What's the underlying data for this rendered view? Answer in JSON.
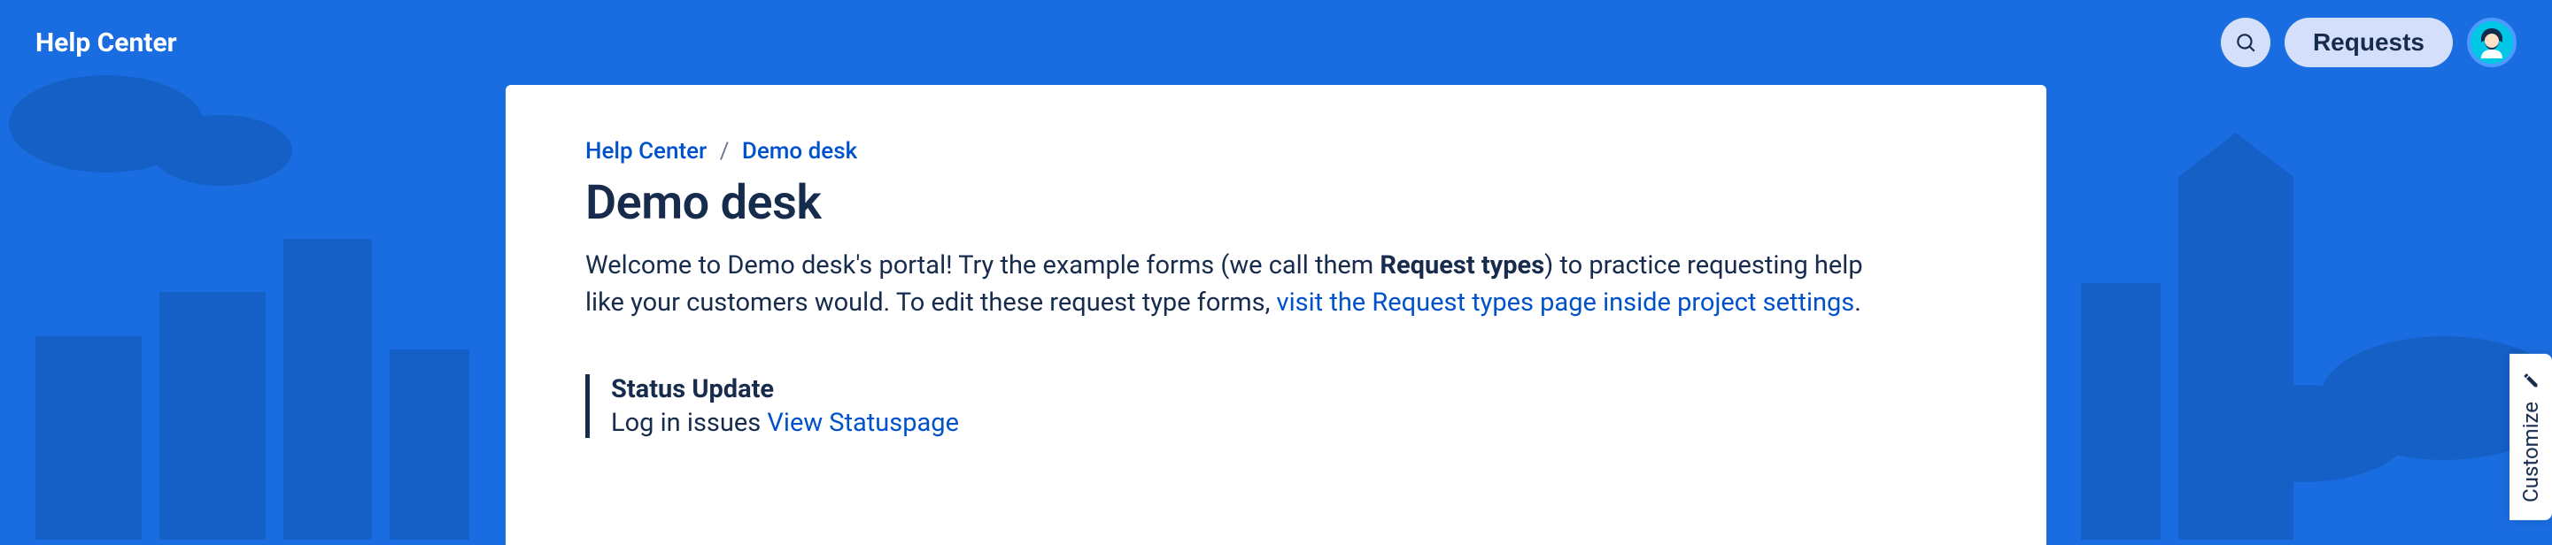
{
  "header": {
    "brand": "Help Center",
    "requests_label": "Requests"
  },
  "breadcrumb": {
    "root": "Help Center",
    "current": "Demo desk"
  },
  "page": {
    "title": "Demo desk",
    "desc_part1": "Welcome to Demo desk's portal! Try the example forms (we call them ",
    "desc_bold": "Request types",
    "desc_part2": ") to practice requesting help like your customers would. To edit these request type forms, ",
    "desc_link": "visit the Request types page inside project settings",
    "desc_part3": "."
  },
  "status": {
    "heading": "Status Update",
    "text": "Log in issues ",
    "link": "View Statuspage"
  },
  "customize": {
    "label": "Customize"
  }
}
